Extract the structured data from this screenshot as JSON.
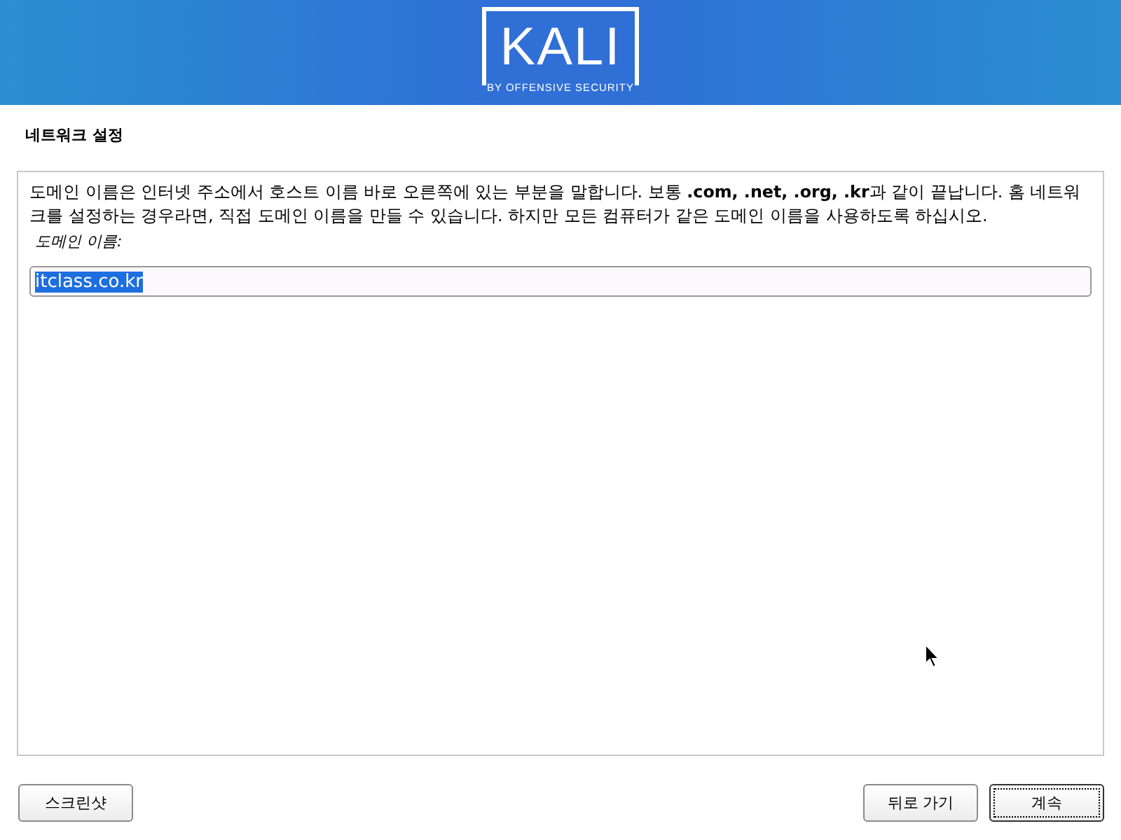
{
  "banner": {
    "logo_text": "KALI",
    "logo_tagline": "BY OFFENSIVE SECURITY"
  },
  "page_title": "네트워크 설정",
  "description": "도메인 이름은 인터넷 주소에서 호스트 이름 바로 오른쪽에 있는 부분을 말합니다. 보통 **.com, .net, .org, .kr**과 같이 끝납니다. 홈 네트워크를 설정하는 경우라면, 직접 도메인 이름을 만들 수 있습니다. 하지만 모든 컴퓨터가 같은 도메인 이름을 사용하도록 하십시오.",
  "field": {
    "label": "도메인 이름:",
    "value": "itclass.co.kr",
    "text_selected": true
  },
  "left_buttons": [
    {
      "label": "스크린샷",
      "focused": false
    }
  ],
  "right_buttons": [
    {
      "label": "뒤로 가기",
      "focused": false
    },
    {
      "label": "계속",
      "focused": true
    }
  ]
}
